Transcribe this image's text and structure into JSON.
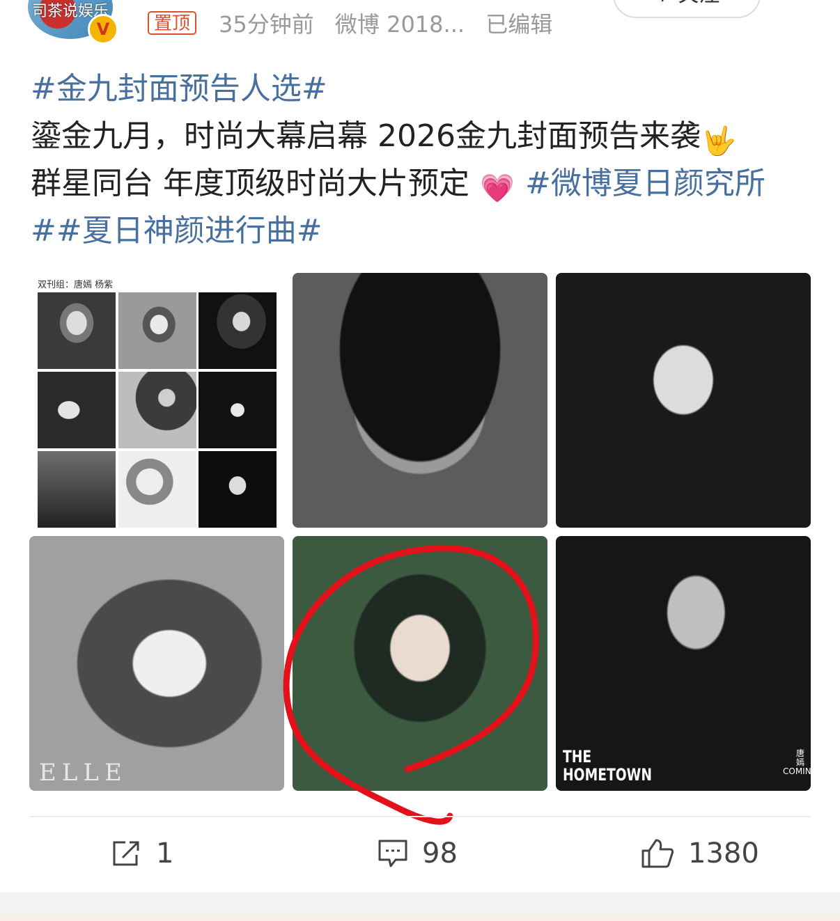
{
  "header": {
    "avatar_text": "司茶说娱乐",
    "verified_mark": "V",
    "pin_label": "置顶",
    "time": "35分钟前",
    "source": "微博 2018...",
    "edited": "已编辑",
    "follow_label": "+ 关注"
  },
  "post": {
    "line1_tag": "#金九封面预告人选#",
    "line2_text": "鎏金九月，时尚大幕启幕 2026金九封面预告来袭",
    "line2_emoji": "🤟",
    "line3_text": "群星同台 年度顶级时尚大片预定",
    "line3_emoji": "💗",
    "line3_tag": "#微博夏日颜究所",
    "line4_tag": "##夏日神颜进行曲#"
  },
  "images": {
    "collage_title": "双刊组：唐嫣 杨紫",
    "elle_logo": "ELLE",
    "hometown_logo_line1": "THE",
    "hometown_logo_line2": "HOMETOWN",
    "tang_logo_line1": "唐",
    "tang_logo_line2": "嫣",
    "tang_logo_line3": "COMING"
  },
  "actions": {
    "repost_count": "1",
    "comment_count": "98",
    "like_count": "1380"
  },
  "colors": {
    "topic_link": "#48709f",
    "pin_badge": "#e0502f",
    "annotation_circle": "#e3111a"
  }
}
